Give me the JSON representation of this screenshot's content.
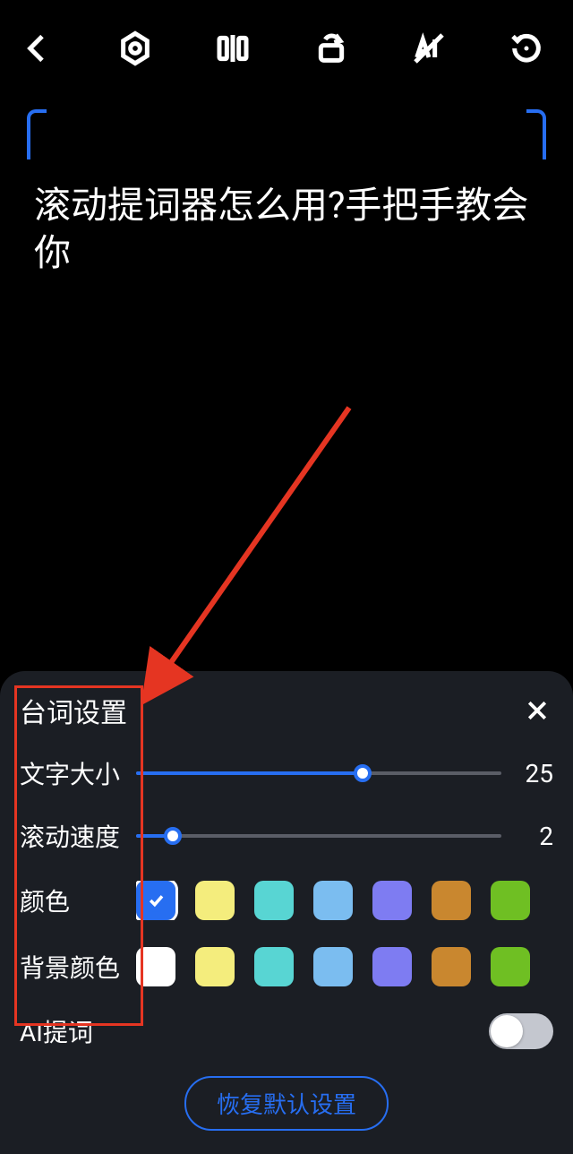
{
  "toolbar": {
    "icons": [
      "back",
      "settings-hex",
      "flip-mirror",
      "rotate-window",
      "ai-off",
      "restore"
    ]
  },
  "prompt": {
    "text": "滚动提词器怎么用?手把手教会你"
  },
  "panel": {
    "title": "台词设置",
    "close": "×",
    "settings": {
      "fontSize": {
        "label": "文字大小",
        "value": 25,
        "percent": 62
      },
      "scrollSpeed": {
        "label": "滚动速度",
        "value": 2,
        "percent": 10
      }
    },
    "colorRow": {
      "label": "颜色",
      "selectedIndex": 0,
      "swatches": [
        "#276ef1",
        "#f4ed7d",
        "#58d5d3",
        "#7bbdf0",
        "#7e7cf2",
        "#c9872f",
        "#6fbf23"
      ]
    },
    "bgColorRow": {
      "label": "背景颜色",
      "selectedIndex": -1,
      "swatches": [
        "#ffffff",
        "#f4ed7d",
        "#58d5d3",
        "#7bbdf0",
        "#7e7cf2",
        "#c9872f",
        "#6fbf23"
      ]
    },
    "aiPrompt": {
      "label": "AI提词",
      "on": false
    },
    "resetButton": "恢复默认设置"
  }
}
